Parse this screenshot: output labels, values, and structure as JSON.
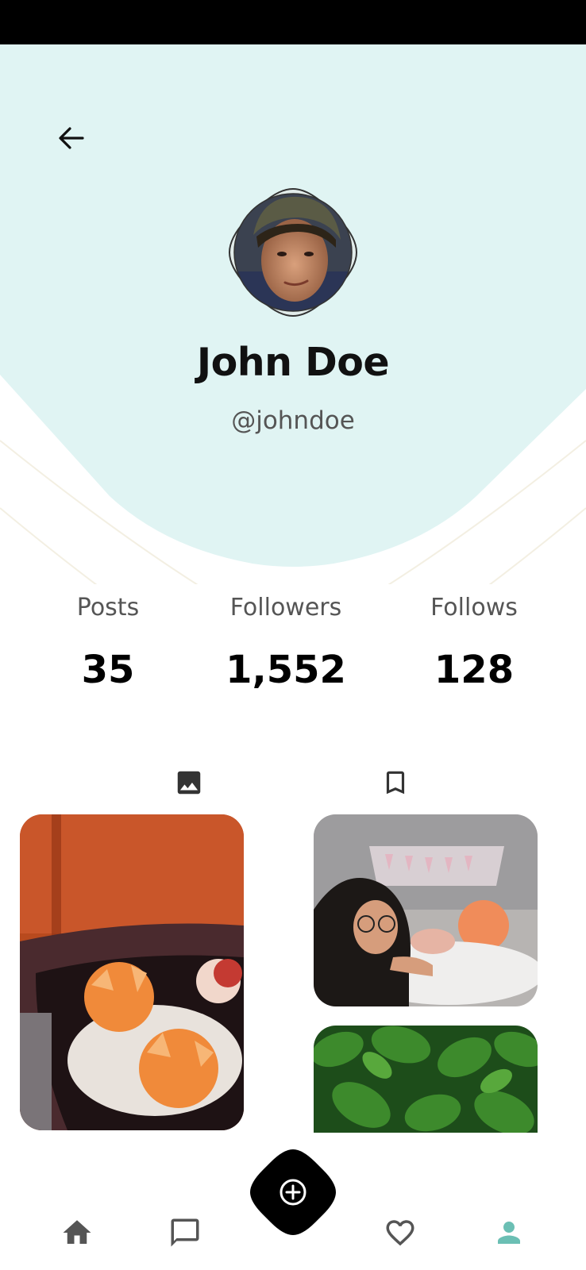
{
  "profile": {
    "name": "John Doe",
    "handle": "@johndoe"
  },
  "stats": [
    {
      "label": "Posts",
      "value": "35"
    },
    {
      "label": "Followers",
      "value": "1,552"
    },
    {
      "label": "Follows",
      "value": "128"
    }
  ],
  "tabs": [
    {
      "icon": "image-icon",
      "active": true
    },
    {
      "icon": "bookmark-icon",
      "active": false
    }
  ],
  "bottom_nav": [
    {
      "icon": "home-icon"
    },
    {
      "icon": "chat-icon"
    },
    {
      "icon": "add-circle-icon"
    },
    {
      "icon": "heart-icon"
    },
    {
      "icon": "person-icon",
      "active": true
    }
  ],
  "colors": {
    "header_bg": "#e0f4f3",
    "accent": "#6bbfb4",
    "text_dark": "#111111",
    "text_muted": "#555555"
  }
}
